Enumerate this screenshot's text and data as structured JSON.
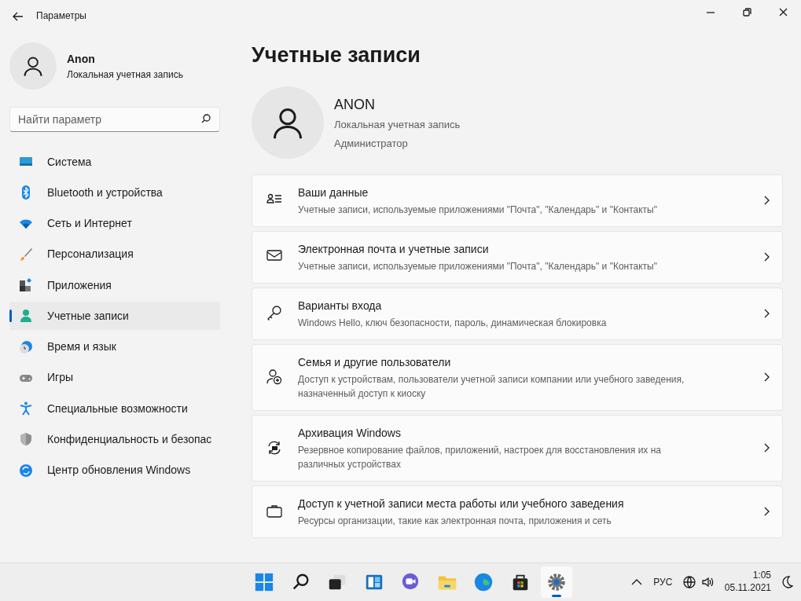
{
  "window": {
    "title": "Параметры"
  },
  "user": {
    "name": "Anon",
    "account_type": "Локальная учетная запись"
  },
  "search": {
    "placeholder": "Найти параметр"
  },
  "sidebar": {
    "items": [
      {
        "label": "Система",
        "selected": false
      },
      {
        "label": "Bluetooth и устройства",
        "selected": false
      },
      {
        "label": "Сеть и Интернет",
        "selected": false
      },
      {
        "label": "Персонализация",
        "selected": false
      },
      {
        "label": "Приложения",
        "selected": false
      },
      {
        "label": "Учетные записи",
        "selected": true
      },
      {
        "label": "Время и язык",
        "selected": false
      },
      {
        "label": "Игры",
        "selected": false
      },
      {
        "label": "Специальные возможности",
        "selected": false
      },
      {
        "label": "Конфиденциальность и безопас",
        "selected": false
      },
      {
        "label": "Центр обновления Windows",
        "selected": false
      }
    ]
  },
  "page": {
    "title": "Учетные записи"
  },
  "profile": {
    "name": "ANON",
    "account_type": "Локальная учетная запись",
    "role": "Администратор"
  },
  "settings": [
    {
      "title": "Ваши данные",
      "description": "Учетные записи, используемые приложениями \"Почта\", \"Календарь\" и \"Контакты\""
    },
    {
      "title": "Электронная почта и учетные записи",
      "description": "Учетные записи, используемые приложениями \"Почта\", \"Календарь\" и \"Контакты\""
    },
    {
      "title": "Варианты входа",
      "description": "Windows Hello, ключ безопасности, пароль, динамическая блокировка"
    },
    {
      "title": "Семья и другие пользователи",
      "description": "Доступ к устройствам, пользователи учетной записи компании или учебного заведения, назначенный доступ к киоску"
    },
    {
      "title": "Архивация Windows",
      "description": "Резервное копирование файлов, приложений, настроек для восстановления их на различных устройствах"
    },
    {
      "title": "Доступ к учетной записи места работы или учебного заведения",
      "description": "Ресурсы организации, такие как электронная почта, приложения и сеть"
    }
  ],
  "taskbar": {
    "apps": [
      {
        "selected": false
      },
      {
        "selected": false
      },
      {
        "selected": false
      },
      {
        "selected": false
      },
      {
        "selected": false
      },
      {
        "selected": false
      },
      {
        "selected": false
      },
      {
        "selected": false
      },
      {
        "selected": true
      }
    ],
    "language": "РУС",
    "time": "1:05",
    "date": "05.11.2021"
  }
}
